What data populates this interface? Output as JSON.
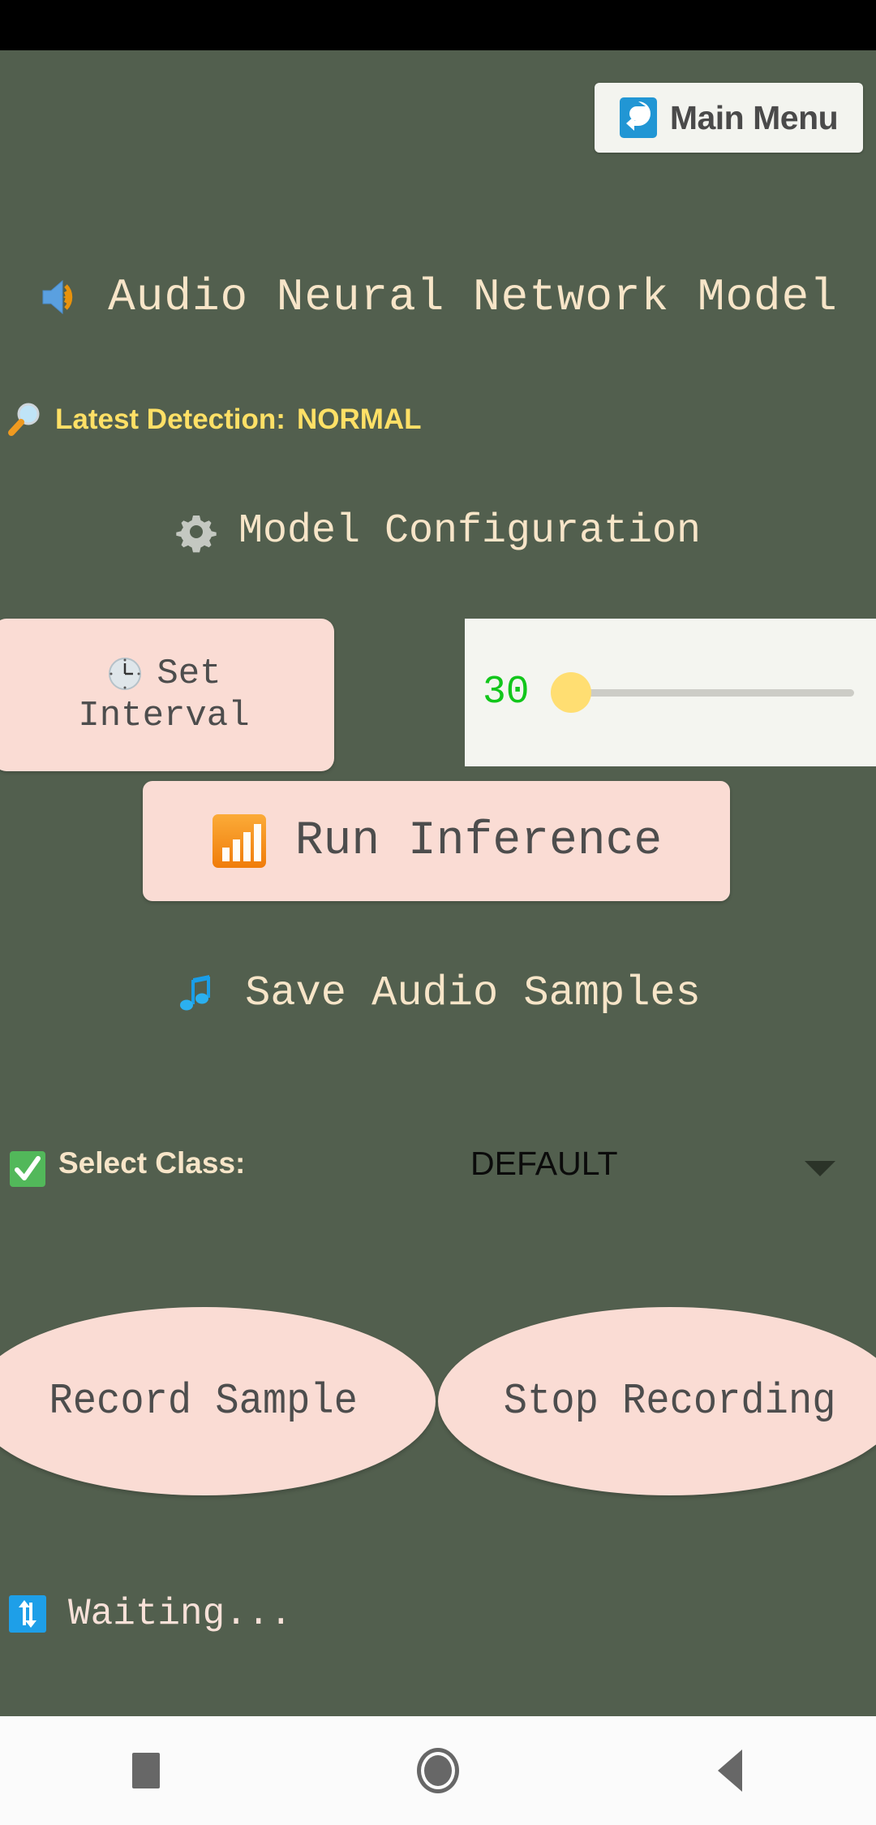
{
  "app": {
    "background_color": "#525f4e",
    "title": "Audio Neural Network Model",
    "title_icon": "speaker-loud-icon"
  },
  "header": {
    "main_menu_label": "Main Menu",
    "main_menu_icon": "return-arrow-icon"
  },
  "detection": {
    "icon": "magnifying-glass-icon",
    "label": "Latest Detection:",
    "value": "NORMAL",
    "color": "#ffe066"
  },
  "config": {
    "icon": "gear-icon",
    "heading": "Model Configuration"
  },
  "interval": {
    "button_label_line1": "Set",
    "button_label_line2": "Interval",
    "button_icon": "clock-icon",
    "slider_value": "30",
    "slider_value_color": "#12c61b",
    "slider_thumb_color": "#ffde72"
  },
  "inference": {
    "icon": "bar-chart-icon",
    "label": "Run Inference"
  },
  "save_samples": {
    "icon": "music-notes-icon",
    "label": "Save Audio Samples"
  },
  "select_class": {
    "icon": "check-mark-icon",
    "label": "Select Class:",
    "selected": "DEFAULT",
    "arrow_icon": "chevron-down-icon"
  },
  "recording": {
    "record_label": "Record Sample",
    "stop_label": "Stop Recording"
  },
  "status": {
    "icon": "refresh-arrows-icon",
    "text": "Waiting..."
  },
  "navbar": {
    "recents_icon": "square-icon",
    "home_icon": "circle-icon",
    "back_icon": "triangle-back-icon"
  }
}
